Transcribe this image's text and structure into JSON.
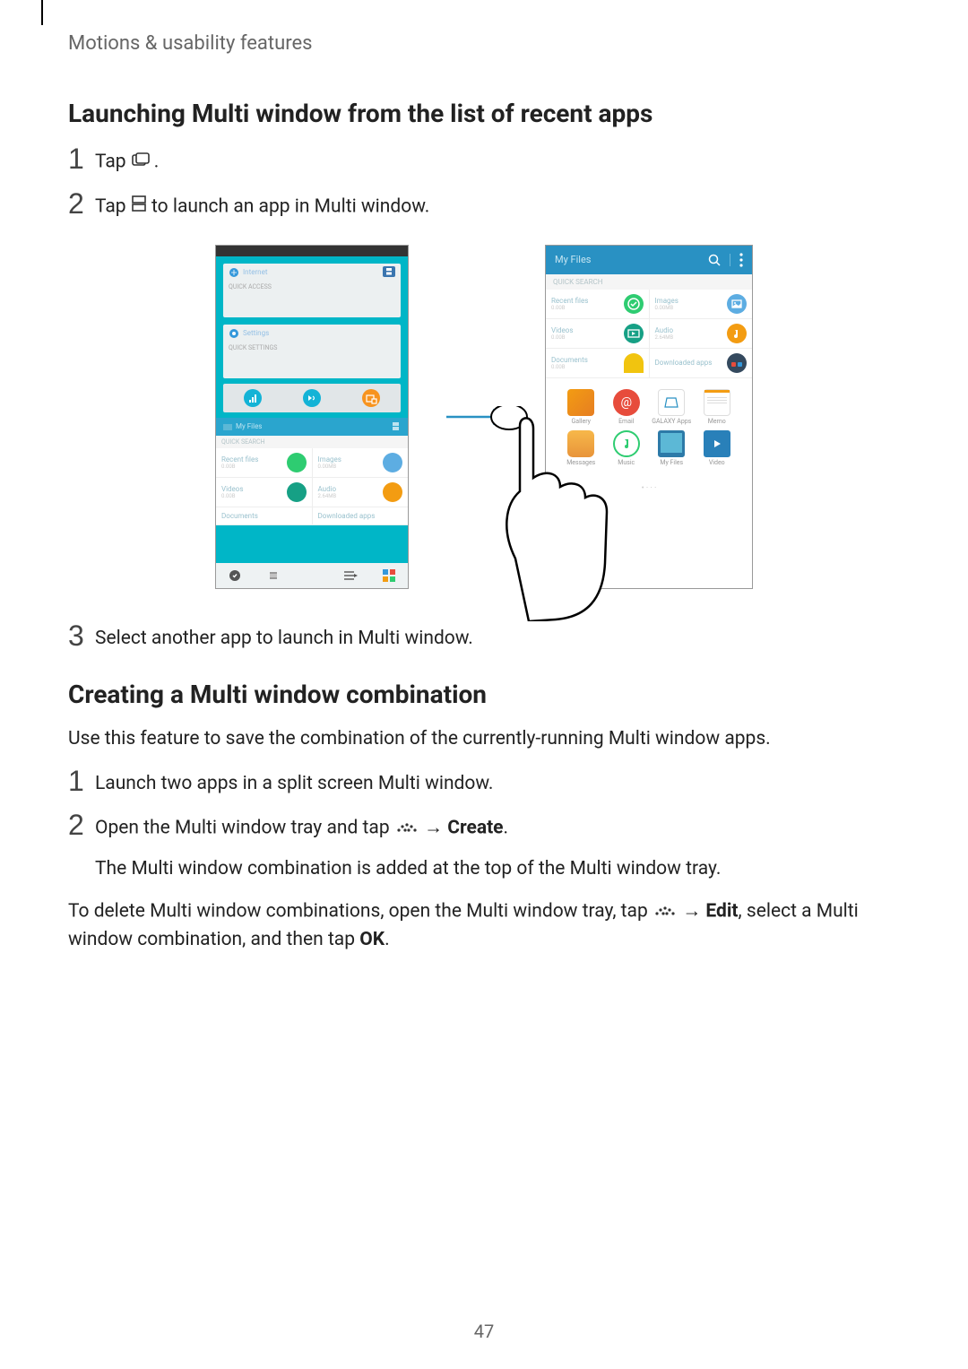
{
  "header": "Motions & usability features",
  "section1": {
    "heading": "Launching Multi window from the list of recent apps",
    "step1_pre": "Tap ",
    "step1_post": ".",
    "step2_pre": "Tap ",
    "step2_post": " to launch an app in Multi window.",
    "step3": "Select another app to launch in Multi window."
  },
  "section2": {
    "heading": "Creating a Multi window combination",
    "intro": "Use this feature to save the combination of the currently-running Multi window apps.",
    "step1": "Launch two apps in a split screen Multi window.",
    "step2_pre": "Open the Multi window tray and tap ",
    "step2_arrow": " → ",
    "step2_bold": "Create",
    "step2_post": ".",
    "step2_result": "The Multi window combination is added at the top of the Multi window tray.",
    "delete_pre": "To delete Multi window combinations, open the Multi window tray, tap ",
    "delete_arrow": " → ",
    "delete_bold1": "Edit",
    "delete_mid": ", select a Multi window combination, and then tap ",
    "delete_bold2": "OK",
    "delete_post": "."
  },
  "screenshot": {
    "quick_access": "QUICK ACCESS",
    "internet": "Internet",
    "settings": "Settings",
    "quick_settings": "QUICK SETTINGS",
    "my_files": "My Files",
    "quick_search": "QUICK SEARCH",
    "recent_files": "Recent files",
    "images": "Images",
    "videos": "Videos",
    "audio": "Audio",
    "documents": "Documents",
    "downloaded": "Downloaded apps",
    "size1": "0.00B",
    "size2": "0.00MB",
    "size3": "2.64MB",
    "apps": {
      "gallery": "Gallery",
      "email": "Email",
      "galaxy": "GALAXY Apps",
      "memo": "Memo",
      "messages": "Messages",
      "music": "Music",
      "myfiles": "My Files",
      "video": "Video"
    }
  },
  "page_number": "47",
  "numbers": {
    "n1": "1",
    "n2": "2",
    "n3": "3"
  }
}
